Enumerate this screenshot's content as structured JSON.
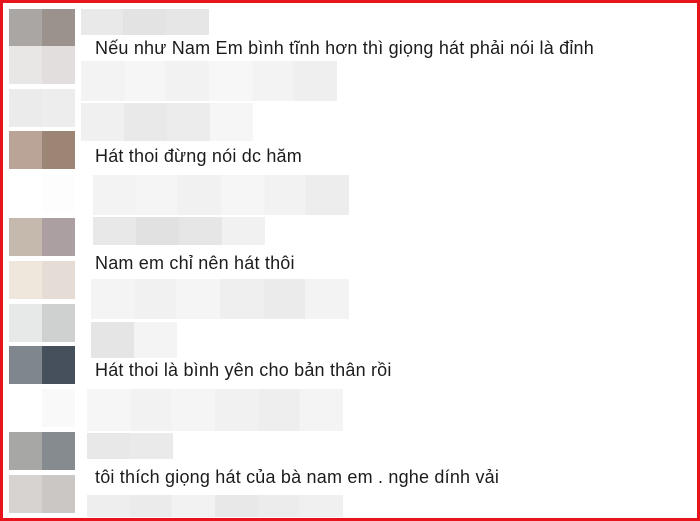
{
  "comments": [
    {
      "text": "Nếu như Nam Em bình tĩnh hơn thì giọng hát phải nói là đỉnh"
    },
    {
      "text": "Hát thoi đừng nói dc hăm"
    },
    {
      "text": "Nam em chỉ nên hát thôi"
    },
    {
      "text": "Hát thoi là bình yên cho bản thân rồi"
    },
    {
      "text": "tôi thích giọng hát của bà nam em . nghe dính vải"
    }
  ],
  "colors": {
    "frame_border": "#e8141b",
    "text": "#1c1c1c"
  }
}
